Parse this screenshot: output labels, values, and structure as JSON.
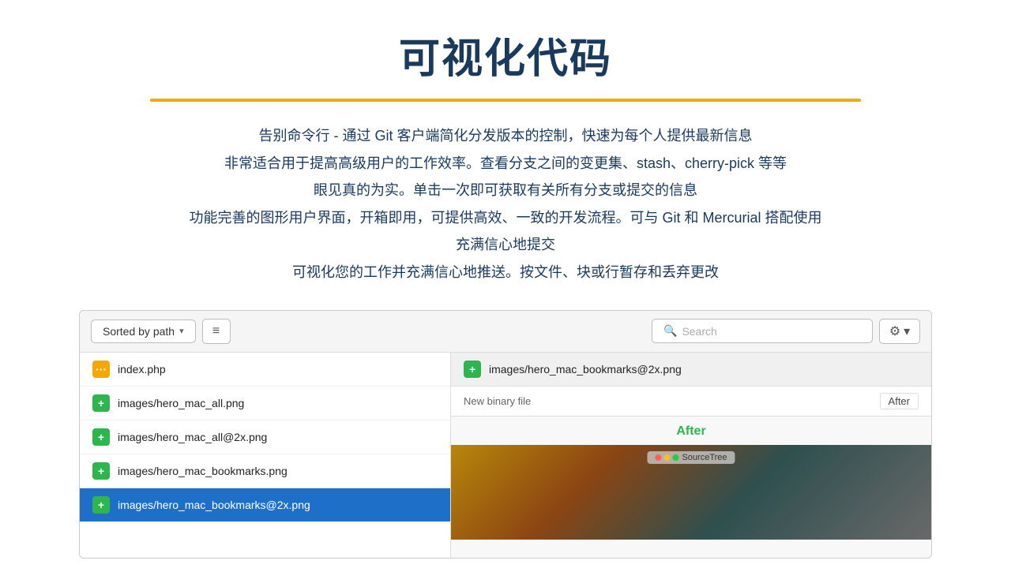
{
  "header": {
    "title": "可视化代码",
    "divider": true
  },
  "descriptions": [
    "告别命令行 - 通过 Git 客户端简化分发版本的控制，快速为每个人提供最新信息",
    "非常适合用于提高高级用户的工作效率。查看分支之间的变更集、stash、cherry-pick 等等",
    "眼见真的为实。单击一次即可获取有关所有分支或提交的信息",
    "功能完善的图形用户界面，开箱即用，可提供高效、一致的开发流程。可与 Git 和 Mercurial 搭配使用",
    "充满信心地提交",
    "可视化您的工作并充满信心地推送。按文件、块或行暂存和丢弃更改"
  ],
  "toolbar": {
    "sort_label": "Sorted by path",
    "sort_icon": "▾",
    "hamburger_icon": "≡",
    "search_placeholder": "Search",
    "search_icon": "🔍",
    "gear_icon": "⚙",
    "gear_chevron": "▾"
  },
  "file_list": {
    "items": [
      {
        "name": "index.php",
        "badge_type": "orange",
        "badge_icon": "···",
        "selected": false
      },
      {
        "name": "images/hero_mac_all.png",
        "badge_type": "green",
        "badge_icon": "+",
        "selected": false
      },
      {
        "name": "images/hero_mac_all@2x.png",
        "badge_type": "green",
        "badge_icon": "+",
        "selected": false
      },
      {
        "name": "images/hero_mac_bookmarks.png",
        "badge_type": "green",
        "badge_icon": "+",
        "selected": false
      },
      {
        "name": "images/hero_mac_bookmarks@2x.png",
        "badge_type": "green",
        "badge_icon": "+",
        "selected": true
      }
    ]
  },
  "diff_panel": {
    "header_file": "images/hero_mac_bookmarks@2x.png",
    "header_badge_type": "green",
    "header_badge_icon": "+",
    "meta_label": "New binary file",
    "after_toggle": "After",
    "after_text": "After",
    "sourcetree_label": "SourceTree"
  }
}
